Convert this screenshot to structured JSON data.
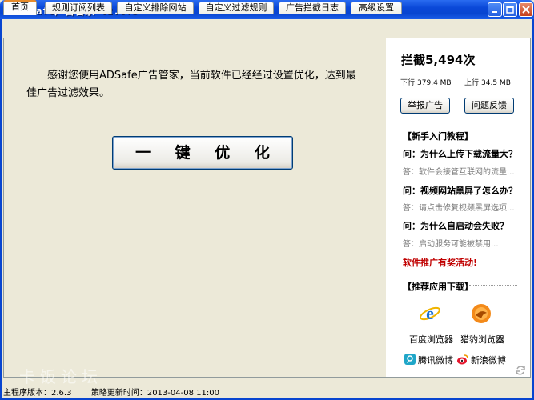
{
  "window": {
    "title": "ADSafe广告管家 v2.6.3"
  },
  "tabs": [
    {
      "label": "首页"
    },
    {
      "label": "规则订阅列表"
    },
    {
      "label": "自定义排除网站"
    },
    {
      "label": "自定义过滤规则"
    },
    {
      "label": "广告拦截日志"
    },
    {
      "label": "高级设置"
    }
  ],
  "main": {
    "intro": "感谢您使用ADSafe广告管家，当前软件已经经过设置优化，达到最佳广告过滤效果。",
    "optimize_button": "一 键 优 化"
  },
  "sidebar": {
    "blocked_count": "拦截5,494次",
    "download": "下行:379.4 MB",
    "upload": "上行:34.5 MB",
    "report_button": "举报广告",
    "feedback_button": "问题反馈",
    "tutorial_title": "【新手入门教程】",
    "faq": [
      {
        "q": "问：为什么上传下载流量大？",
        "a": "答：软件会接管互联网的流量..."
      },
      {
        "q": "问：视频网站黑屏了怎么办？",
        "a": "答：请点击修复视频黑屏选项..."
      },
      {
        "q": "问：为什么自启动会失败？",
        "a": "答：启动服务可能被禁用..."
      }
    ],
    "promo": "软件推广有奖活动!",
    "apps_title": "【推荐应用下载】",
    "apps": [
      {
        "label": "百度浏览器",
        "icon": "ie-icon"
      },
      {
        "label": "猎豹浏览器",
        "icon": "cheetah-icon"
      }
    ],
    "weibo": [
      {
        "label": "腾讯微博",
        "icon": "tencent-weibo-icon"
      },
      {
        "label": "新浪微博",
        "icon": "sina-weibo-icon"
      }
    ]
  },
  "status": {
    "version": "主程序版本：2.6.3",
    "update_time": "策略更新时间：2013-04-08 11:00"
  },
  "watermark": "卡饭论坛",
  "colors": {
    "title_bar": "#0845d0",
    "promo": "#c00000",
    "tab_highlight": "#e68b2c"
  }
}
